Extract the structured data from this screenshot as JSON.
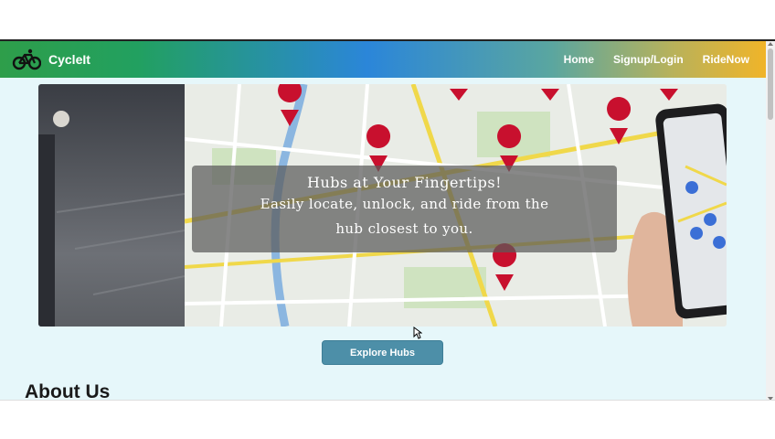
{
  "navbar": {
    "brand": "CycleIt",
    "links": [
      "Home",
      "Signup/Login",
      "RideNow"
    ]
  },
  "hero": {
    "caption_title": "Hubs at Your Fingertips!",
    "caption_line1": "Easily locate, unlock, and ride from the",
    "caption_line2": "hub closest to you."
  },
  "explore_button": "Explore Hubs",
  "about": {
    "heading": "About Us"
  },
  "colors": {
    "accent_button": "#4d8fa8",
    "page_background": "#e6f7fa",
    "pin_red": "#c8102e"
  },
  "icons": {
    "brand": "bicycle-icon",
    "map_pin": "map-pin-icon"
  }
}
